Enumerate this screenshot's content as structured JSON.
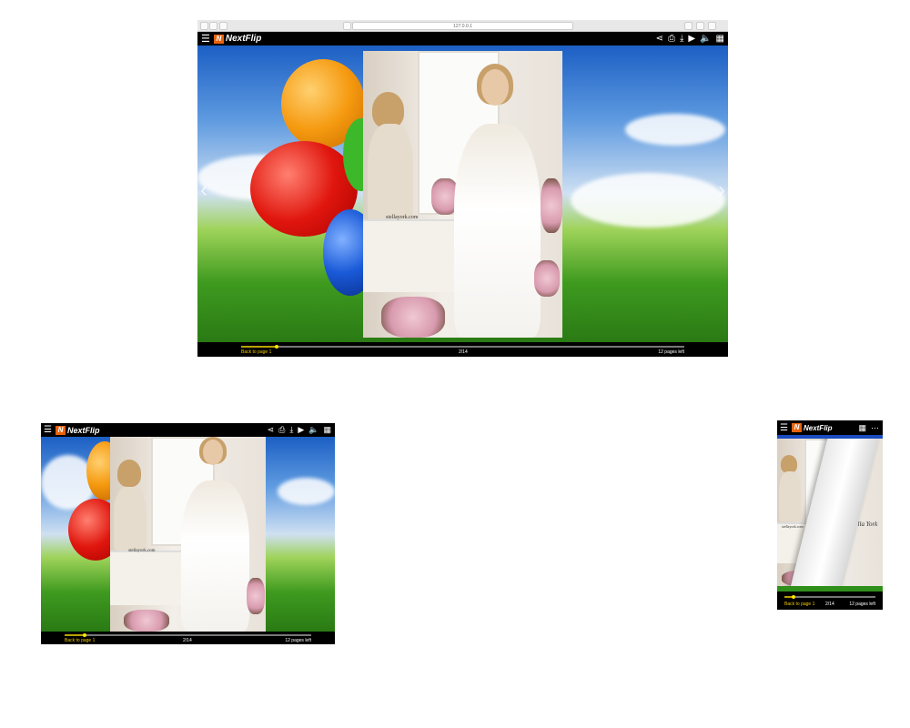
{
  "browser": {
    "url": "127.0.0.1"
  },
  "app": {
    "name": "NextFlip",
    "logo_mark": "N"
  },
  "toolbar": {
    "icons": [
      "share-icon",
      "print-icon",
      "download-icon",
      "play-icon",
      "sound-icon",
      "thumbnails-icon"
    ]
  },
  "page": {
    "watermark": "stellayork.com",
    "phone_watermark": "Stella York"
  },
  "footer": {
    "back_label": "Back to page 1",
    "page_indicator": "2/14",
    "pages_left": "12 pages left",
    "progress": 0.13
  },
  "colors": {
    "accent": "#f0c800",
    "logo": "#e8620c",
    "toolbar": "#000000"
  }
}
